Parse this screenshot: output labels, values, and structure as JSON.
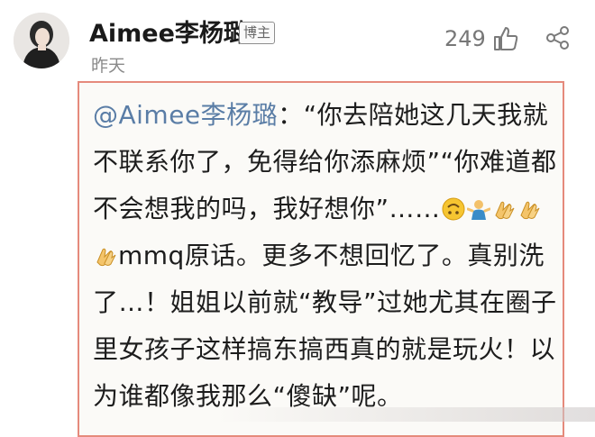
{
  "post": {
    "username": "Aimee李杨璐",
    "badge": "博主",
    "timestamp": "昨天",
    "like_count": "249"
  },
  "comment": {
    "mention": "@Aimee李杨璐",
    "part1": "：“你去陪她这几天我就不联系你了，免得给你添麻烦”“你难道都不会想我的吗，我好想你”……",
    "part2": "mmq原话。更多不想回忆了。真别洗了…！姐姐以前就“教导”过她尤其在圈子里女孩子这样搞东搞西真的就是玩火！以为谁都像我那么“傻缺”呢。",
    "emojis": [
      "upside-down-face-emoji",
      "person-shrugging-emoji",
      "clapping-hands-emoji",
      "clapping-hands-emoji",
      "clapping-hands-emoji"
    ]
  },
  "colors": {
    "mention": "#5a7da6",
    "frame": "#e58a7c",
    "badge_border": "#8e8e8e"
  }
}
